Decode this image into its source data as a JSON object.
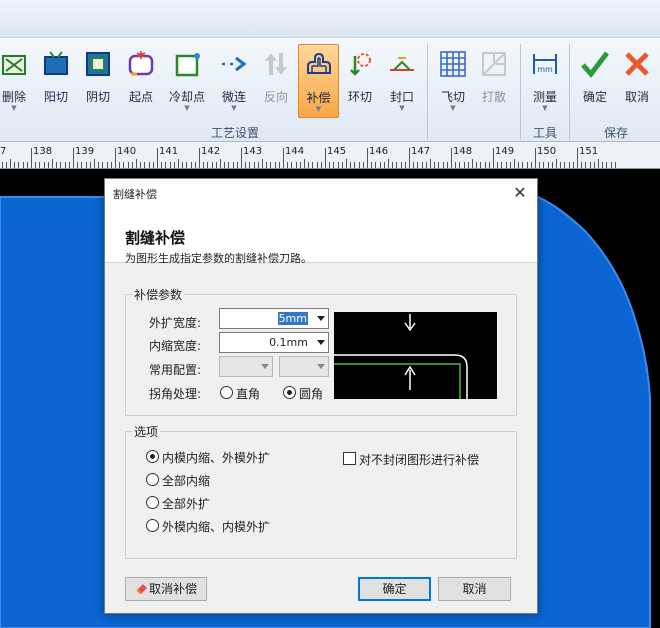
{
  "ribbon": {
    "buttons": [
      {
        "id": "delete",
        "label": "删除",
        "icon": "delete-icon",
        "has_arrow": true
      },
      {
        "id": "outer-cut",
        "label": "阳切",
        "icon": "outer-cut-icon",
        "has_arrow": false
      },
      {
        "id": "inner-cut",
        "label": "阴切",
        "icon": "inner-cut-icon",
        "has_arrow": false
      },
      {
        "id": "lead-in",
        "label": "起点",
        "icon": "lead-in-icon",
        "has_arrow": false
      },
      {
        "id": "cooling-point",
        "label": "冷却点",
        "icon": "cooling-point-icon",
        "has_arrow": true
      },
      {
        "id": "micro-joint",
        "label": "微连",
        "icon": "micro-joint-icon",
        "has_arrow": true
      },
      {
        "id": "reverse",
        "label": "反向",
        "icon": "reverse-icon",
        "has_arrow": false
      },
      {
        "id": "kerf",
        "label": "补偿",
        "icon": "kerf-icon",
        "has_arrow": true
      },
      {
        "id": "ring-cut",
        "label": "环切",
        "icon": "ring-cut-icon",
        "has_arrow": false
      },
      {
        "id": "seal",
        "label": "封口",
        "icon": "seal-icon",
        "has_arrow": true
      },
      {
        "id": "fly-cut",
        "label": "飞切",
        "icon": "fly-cut-icon",
        "has_arrow": true
      },
      {
        "id": "break-up",
        "label": "打散",
        "icon": "break-up-icon",
        "has_arrow": false
      },
      {
        "id": "measure",
        "label": "测量",
        "icon": "measure-icon",
        "has_arrow": true
      },
      {
        "id": "confirm",
        "label": "确定",
        "icon": "confirm-check-icon",
        "has_arrow": false
      },
      {
        "id": "cancel",
        "label": "取消",
        "icon": "cancel-x-icon",
        "has_arrow": false
      }
    ],
    "groups": {
      "process": "工艺设置",
      "tools": "工具",
      "save": "保存"
    },
    "active": "kerf"
  },
  "ruler": {
    "numbers": [
      "7",
      "138",
      "139",
      "140",
      "141",
      "142",
      "143",
      "144",
      "145",
      "146",
      "147",
      "148",
      "149",
      "150",
      "151"
    ]
  },
  "dialog": {
    "title": "割缝补偿",
    "close": "✕",
    "heading": "割缝补偿",
    "subtitle": "为图形生成指定参数的割缝补偿刀路。",
    "params": {
      "legend": "补偿参数",
      "outer_width_label": "外扩宽度:",
      "outer_width_value": "5mm",
      "inner_width_label": "内缩宽度:",
      "inner_width_value": "0.1mm",
      "common_config_label": "常用配置:",
      "corner_label": "拐角处理:",
      "corner_square": "直角",
      "corner_round": "圆角",
      "corner_selected": "round"
    },
    "options": {
      "legend": "选项",
      "items": [
        {
          "id": "opt-inner-shrink-outer-expand",
          "label": "内模内缩、外模外扩",
          "checked": true
        },
        {
          "id": "opt-all-shrink",
          "label": "全部内缩",
          "checked": false
        },
        {
          "id": "opt-all-expand",
          "label": "全部外扩",
          "checked": false
        },
        {
          "id": "opt-outer-shrink-inner-expand",
          "label": "外模内缩、内模外扩",
          "checked": false
        }
      ],
      "open_shapes_label": "对不封闭图形进行补偿",
      "open_shapes_checked": false
    },
    "buttons": {
      "remove": "取消补偿",
      "ok": "确定",
      "cancel": "取消"
    }
  }
}
